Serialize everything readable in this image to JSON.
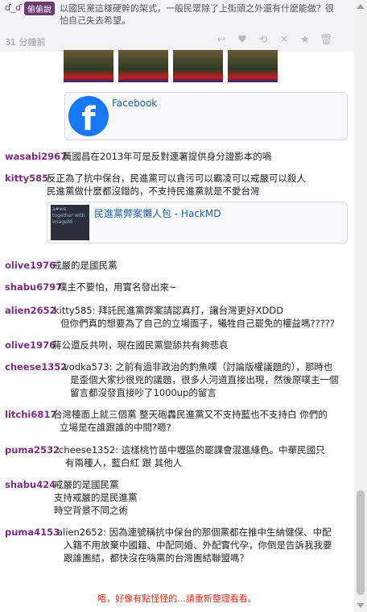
{
  "top_comment": {
    "user": "ɗ_ɗ",
    "badge": "偷偷說",
    "text_lines": [
      "以國民黨這樣硬幹的架式，一般民眾除了上街頭之外還有什麼能做？很",
      "怕自己失去希望。"
    ],
    "time": "31 分鐘前"
  },
  "actions": [
    "reply-icon",
    "like-icon",
    "retweet-icon",
    "dislike-icon",
    "star-icon",
    "delete-icon"
  ],
  "facebook_card": {
    "title": "Facebook"
  },
  "comments": [
    {
      "user": "wasabi2967",
      "lines": [
        "黃國昌在2013年可是反對連署提供身分證影本的喎"
      ]
    },
    {
      "user": "kitty585",
      "lines": [
        "反正為了抗中保台，民進黨可以貪污可以霸凌可以戒嚴可以殺人",
        "民進黨做什麼都沒錯的，不支持民進黨就是不愛台灣"
      ]
    },
    {
      "user": "olive1976",
      "lines": [
        "戒嚴的是國民黨"
      ]
    },
    {
      "user": "shabu6797",
      "lines": [
        "噗主不要怕，用實名發出來~"
      ]
    },
    {
      "user": "alien2652",
      "lines": [
        "kitty585: 拜託民進黨弊案請認真打，讓台灣更好XDDD",
        "但你們真的想要為了自己的立場面子，犧牲自己罷免的權益嗎?????"
      ]
    },
    {
      "user": "olive1976",
      "lines": [
        "蔣公還反共咧，現在國民黨變舔共有夠悲哀"
      ]
    },
    {
      "user": "cheese1352",
      "lines": [
        "vodka573: 之前有過非政治的釣魚噗（討論版權議題的），那時也",
        "是歪個大家抄很兇的議題，很多人河道直接出現，然後原噗主一個",
        "留言都沒發直接吵了1000up的留言"
      ]
    },
    {
      "user": "litchi6817",
      "lines": [
        "台灣檯面上就三個黨 整天砲轟民進黨又不支持藍也不支持白 你們的",
        "立場是在誰跟誰的中間?嗯?"
      ]
    },
    {
      "user": "puma2532",
      "lines": [
        "cheese1352: 這樣桃竹苗中壢區的罷課會混進綠色。中華民國只",
        "有兩種人，藍白紅 跟 其他人"
      ]
    },
    {
      "user": "shabu424",
      "lines": [
        "戒嚴的是國民黨",
        "支持戒嚴的是民進黨",
        "時空背景不同之術"
      ]
    },
    {
      "user": "puma4153",
      "lines": [
        "alien2652: 因為連號稱抗中保台的那個黨都在推中生納健保、中配",
        "入籍不用放棄中國籍、中配同婚、外配實代孕，你倒是告訴我我要",
        "跟誰團結，都快沒在嗨黨的台灣團結聯盟嗎？"
      ]
    }
  ],
  "hackmd_card": {
    "title": "民進黨弊案懶人包 - HackMD",
    "thumb_text": "a#we together with imageMi"
  },
  "error_text": "唔，好像有點怪怪的...請重新整理看看。"
}
